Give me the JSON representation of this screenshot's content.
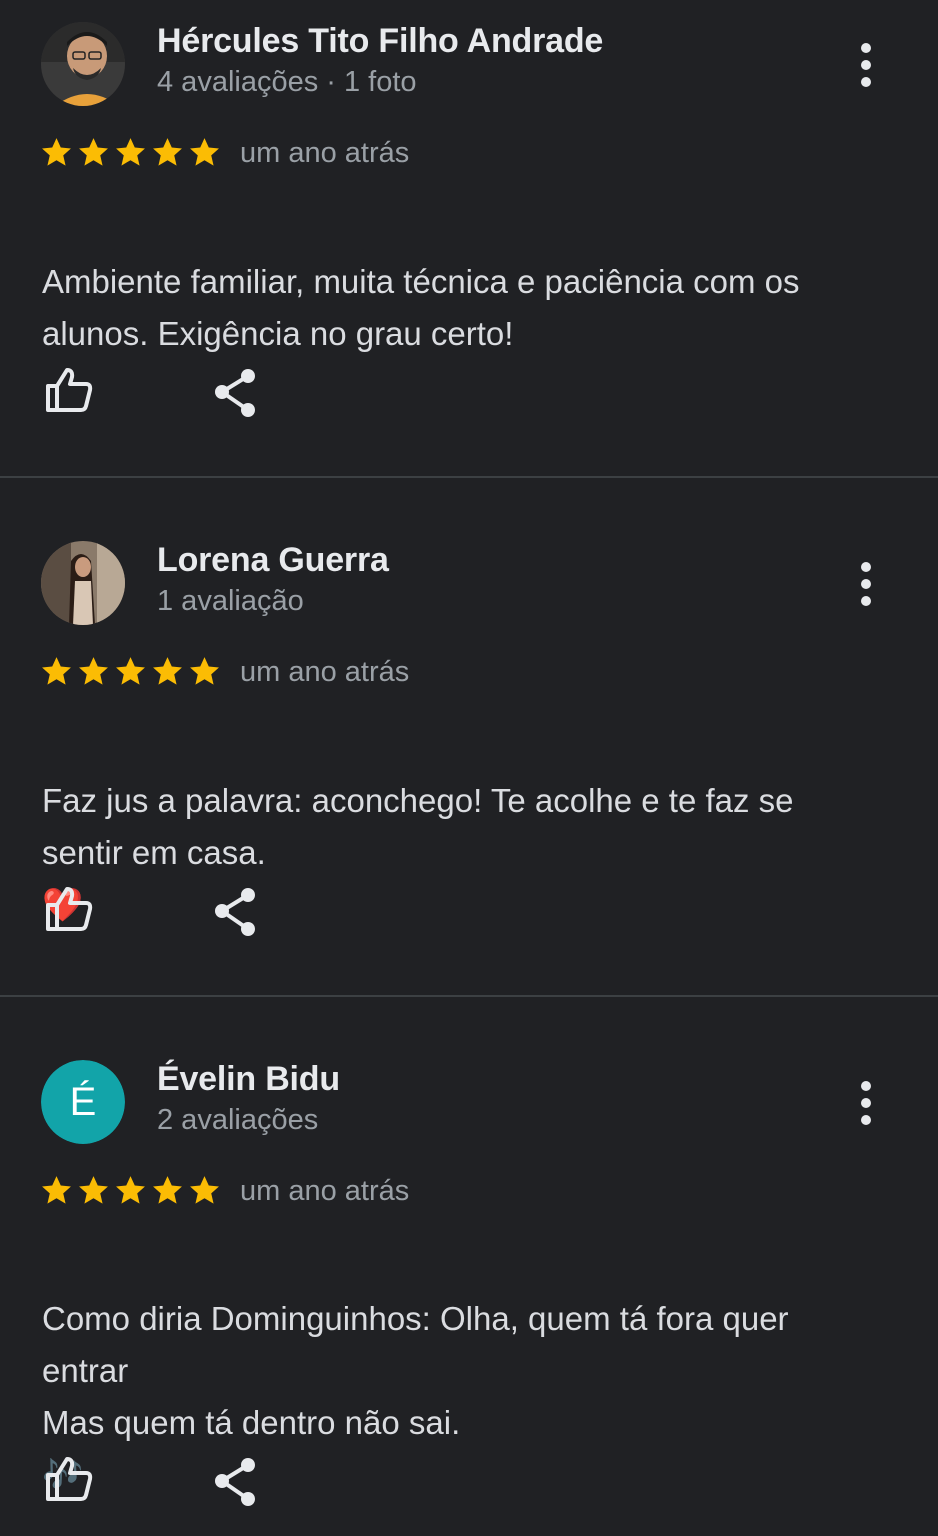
{
  "colors": {
    "background": "#202124",
    "star": "#fbbc04",
    "divider": "#3c4043",
    "avatar_evelin": "#12a4a9"
  },
  "reviews": [
    {
      "name": "Hércules Tito Filho Andrade",
      "meta": "4 avaliações · 1 foto",
      "rating": 5,
      "time": "um ano atrás",
      "text": "Ambiente familiar, muita técnica e paciência com os\nalunos. Exigência no grau certo!",
      "avatar": "photo"
    },
    {
      "name": "Lorena Guerra",
      "meta": "1 avaliação",
      "rating": 5,
      "time": "um ano atrás",
      "text": "Faz jus a palavra: aconchego! Te acolhe e te faz se\nsentir em casa.",
      "emoji": "❤️",
      "avatar": "photo"
    },
    {
      "name": "Évelin Bidu",
      "meta": "2 avaliações",
      "rating": 5,
      "time": "um ano atrás",
      "text": "Como diria Dominguinhos: Olha, quem tá fora quer\nentrar\nMas quem tá dentro não sai.",
      "emoji": "🎶",
      "avatar_letter": "É"
    }
  ],
  "icons": {
    "more": "more-vert-icon",
    "like": "thumbs-up-icon",
    "share": "share-icon",
    "star": "star-icon"
  }
}
